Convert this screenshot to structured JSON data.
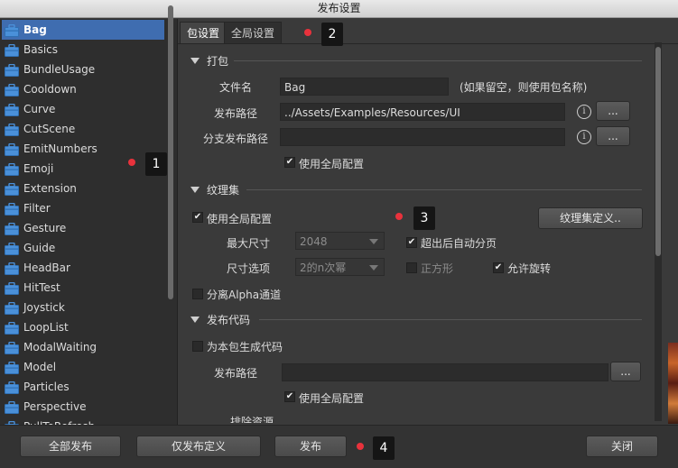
{
  "window": {
    "title": "发布设置"
  },
  "sidebar": {
    "items": [
      {
        "label": "Bag",
        "selected": true
      },
      {
        "label": "Basics"
      },
      {
        "label": "BundleUsage"
      },
      {
        "label": "Cooldown"
      },
      {
        "label": "Curve"
      },
      {
        "label": "CutScene"
      },
      {
        "label": "EmitNumbers"
      },
      {
        "label": "Emoji"
      },
      {
        "label": "Extension"
      },
      {
        "label": "Filter"
      },
      {
        "label": "Gesture"
      },
      {
        "label": "Guide"
      },
      {
        "label": "HeadBar"
      },
      {
        "label": "HitTest"
      },
      {
        "label": "Joystick"
      },
      {
        "label": "LoopList"
      },
      {
        "label": "ModalWaiting"
      },
      {
        "label": "Model"
      },
      {
        "label": "Particles"
      },
      {
        "label": "Perspective"
      },
      {
        "label": "PullToRefresh"
      }
    ]
  },
  "tabs": [
    {
      "label": "包设置",
      "active": true
    },
    {
      "label": "全局设置"
    }
  ],
  "sections": {
    "package": {
      "title": "打包",
      "file_name_label": "文件名",
      "file_name_value": "Bag",
      "file_name_hint": "(如果留空，则使用包名称)",
      "publish_path_label": "发布路径",
      "publish_path_value": "../Assets/Examples/Resources/UI",
      "branch_path_label": "分支发布路径",
      "branch_path_value": "",
      "use_global_label": "使用全局配置",
      "use_global_checked": true
    },
    "atlas": {
      "title": "纹理集",
      "use_global_label": "使用全局配置",
      "use_global_checked": true,
      "define_button": "纹理集定义..",
      "max_size_label": "最大尺寸",
      "max_size_value": "2048",
      "auto_split_label": "超出后自动分页",
      "auto_split_checked": true,
      "size_option_label": "尺寸选项",
      "size_option_value": "2的n次幂",
      "square_label": "正方形",
      "square_checked": false,
      "rotate_label": "允许旋转",
      "rotate_checked": true,
      "alpha_label": "分离Alpha通道",
      "alpha_checked": false
    },
    "code": {
      "title": "发布代码",
      "gen_code_label": "为本包生成代码",
      "gen_code_checked": false,
      "publish_path_label": "发布路径",
      "publish_path_value": "",
      "use_global_label": "使用全局配置",
      "use_global_checked": true,
      "exclude_label": "排除资源"
    }
  },
  "buttons": {
    "ellipsis": "...",
    "info": "i"
  },
  "footer": {
    "publish_all": "全部发布",
    "publish_def_only": "仅发布定义",
    "publish": "发布",
    "close": "关闭"
  },
  "markers": [
    "1",
    "2",
    "3",
    "4"
  ],
  "colors": {
    "selection": "#3f6db0",
    "marker_dot": "#e8323c",
    "icon_blue": "#4a90d9"
  },
  "icons": {
    "sidebar_item": "package-icon"
  }
}
